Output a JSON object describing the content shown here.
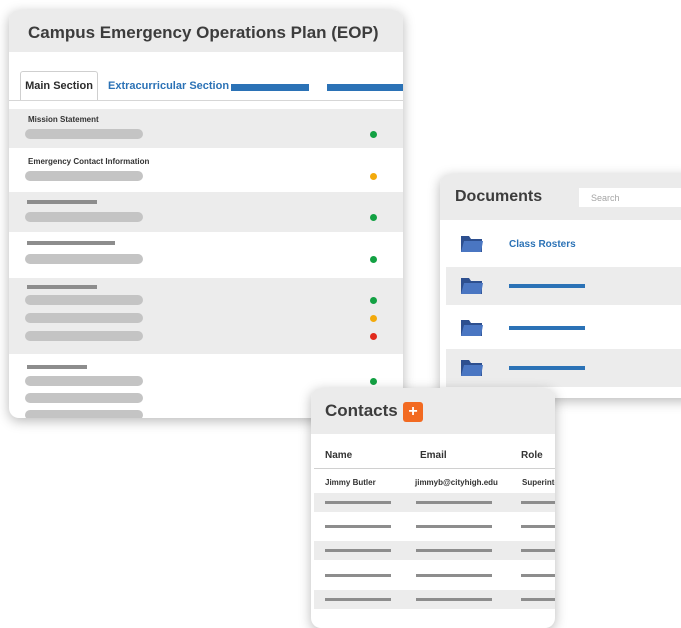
{
  "eop": {
    "title": "Campus Emergency Operations Plan (EOP)",
    "tabs": [
      "Main Section",
      "Extracurricular Section"
    ],
    "rows": [
      {
        "label": "Mission Statement",
        "statuses": [
          "green"
        ]
      },
      {
        "label": "Emergency Contact Information",
        "statuses": [
          "yellow"
        ]
      },
      {
        "label": "",
        "statuses": [
          "green"
        ]
      },
      {
        "label": "",
        "statuses": [
          "green"
        ]
      },
      {
        "label": "",
        "statuses": [
          "green",
          "yellow",
          "red"
        ]
      },
      {
        "label": "",
        "statuses": [
          "green"
        ]
      }
    ]
  },
  "documents": {
    "title": "Documents",
    "search_placeholder": "Search",
    "items": [
      {
        "label": "Class Rosters",
        "icon": "folder-icon"
      },
      {
        "label": "",
        "icon": "folder-icon"
      },
      {
        "label": "",
        "icon": "folder-icon"
      },
      {
        "label": "",
        "icon": "folder-icon"
      }
    ]
  },
  "contacts": {
    "title": "Contacts",
    "add_label": "+",
    "columns": [
      "Name",
      "Email",
      "Role"
    ],
    "first_row": [
      "Jimmy Butler",
      "jimmyb@cityhigh.edu",
      "Superintendent"
    ]
  },
  "colors": {
    "accent_blue": "#2b72b6",
    "status_green": "#13a143",
    "status_yellow": "#f3aa0c",
    "status_red": "#e12a1c",
    "add_orange": "#f26a21",
    "folder_blue": "#3f66ad"
  }
}
